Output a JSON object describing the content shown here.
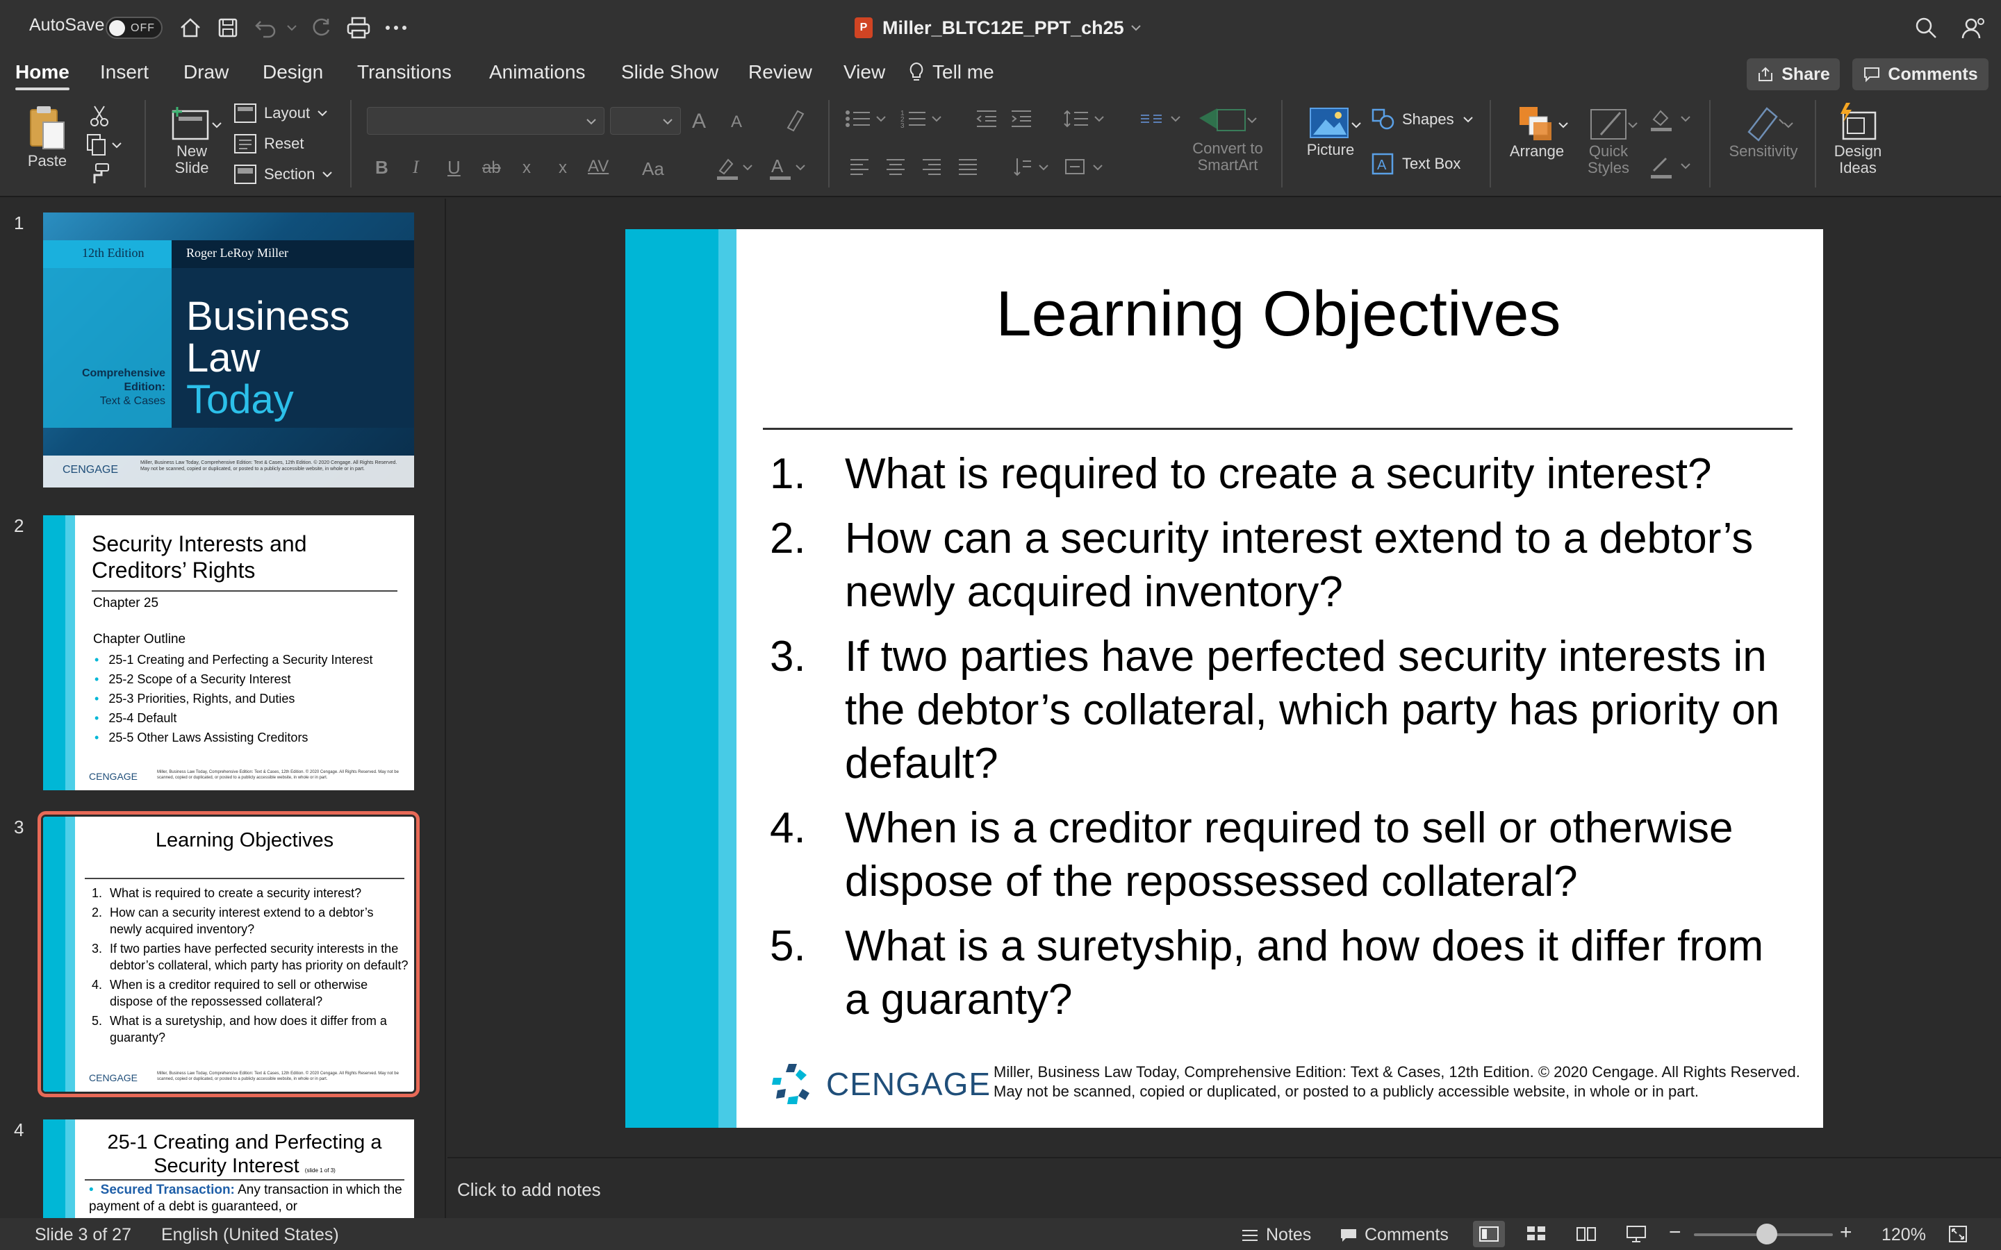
{
  "titlebar": {
    "autosave_label": "AutoSave",
    "autosave_state": "OFF",
    "document_title": "Miller_BLTC12E_PPT_ch25",
    "ppt_badge": "P"
  },
  "tabs": [
    "Home",
    "Insert",
    "Draw",
    "Design",
    "Transitions",
    "Animations",
    "Slide Show",
    "Review",
    "View"
  ],
  "tell_me": "Tell me",
  "share_label": "Share",
  "comments_label": "Comments",
  "ribbon": {
    "paste": "Paste",
    "new_slide": "New Slide",
    "layout": "Layout",
    "reset": "Reset",
    "section": "Section",
    "convert_smartart": "Convert to SmartArt",
    "picture": "Picture",
    "shapes": "Shapes",
    "text_box": "Text Box",
    "arrange": "Arrange",
    "quick_styles": "Quick Styles",
    "sensitivity": "Sensitivity",
    "design_ideas": "Design Ideas",
    "font_inc": "A",
    "font_dec": "A",
    "bold": "B",
    "italic": "I",
    "underline": "U",
    "strike": "ab",
    "superscript": "x",
    "subscript": "x",
    "char_spacing": "AV",
    "change_case": "Aa"
  },
  "thumbnails": [
    {
      "num": "1",
      "edition": "12th Edition",
      "author": "Roger LeRoy Miller",
      "title_lines": [
        "Business",
        "Law",
        "Today"
      ],
      "side_text": [
        "Comprehensive",
        "Edition:",
        "Text & Cases"
      ],
      "logo": "CENGAGE",
      "copy": "Miller, Business Law Today, Comprehensive Edition: Text & Cases, 12th Edition. © 2020 Cengage. All Rights Reserved. May not be scanned, copied or duplicated, or posted to a publicly accessible website, in whole or in part."
    },
    {
      "num": "2",
      "title": "Security Interests and Creditors’ Rights",
      "subtitle": "Chapter 25",
      "outline_label": "Chapter Outline",
      "items": [
        "25-1 Creating and Perfecting a Security Interest",
        "25-2 Scope of a Security Interest",
        "25-3 Priorities, Rights, and Duties",
        "25-4 Default",
        "25-5 Other Laws Assisting Creditors"
      ],
      "logo": "CENGAGE",
      "copy": "Miller, Business Law Today, Comprehensive Edition: Text & Cases, 12th Edition. © 2020 Cengage. All Rights Reserved. May not be scanned, copied or duplicated, or posted to a publicly accessible website, in whole or in part."
    },
    {
      "num": "3",
      "title": "Learning Objectives",
      "logo": "CENGAGE",
      "copy": "Miller, Business Law Today, Comprehensive Edition: Text & Cases, 12th Edition. © 2020 Cengage. All Rights Reserved. May not be scanned, copied or duplicated, or posted to a publicly accessible website, in whole or in part."
    },
    {
      "num": "4",
      "title": "25-1 Creating and Perfecting a Security Interest",
      "slide_note": "(slide 1 of 3)",
      "term": "Secured Transaction:",
      "body": "Any transaction in which the payment of a debt is guaranteed, or"
    }
  ],
  "slide": {
    "title": "Learning Objectives",
    "objectives": [
      {
        "num": "1.",
        "text": "What is required to create a security interest?"
      },
      {
        "num": "2.",
        "text": "How can a security interest extend to a debtor’s newly acquired inventory?"
      },
      {
        "num": "3.",
        "text": "If two parties have perfected security interests in the debtor’s collateral, which party has priority on default?"
      },
      {
        "num": "4.",
        "text": "When is a creditor required to sell or otherwise dispose of the repossessed collateral?"
      },
      {
        "num": "5.",
        "text": "What is a suretyship, and how does it differ from a guaranty?"
      }
    ],
    "logo": "CENGAGE",
    "copyright": "Miller, Business Law Today, Comprehensive Edition: Text & Cases, 12th Edition. © 2020 Cengage. All Rights Reserved. May not be scanned, copied or duplicated, or posted to a publicly accessible website, in whole or in part."
  },
  "notes_placeholder": "Click to add notes",
  "status": {
    "slide_indicator": "Slide 3 of 27",
    "language": "English (United States)",
    "notes": "Notes",
    "comments": "Comments",
    "zoom": "120%",
    "zoom_minus": "−",
    "zoom_plus": "+"
  },
  "colors": {
    "accent_bar": "#00b6d6",
    "selection": "#e86a57",
    "cengage_blue": "#1f4e79"
  }
}
